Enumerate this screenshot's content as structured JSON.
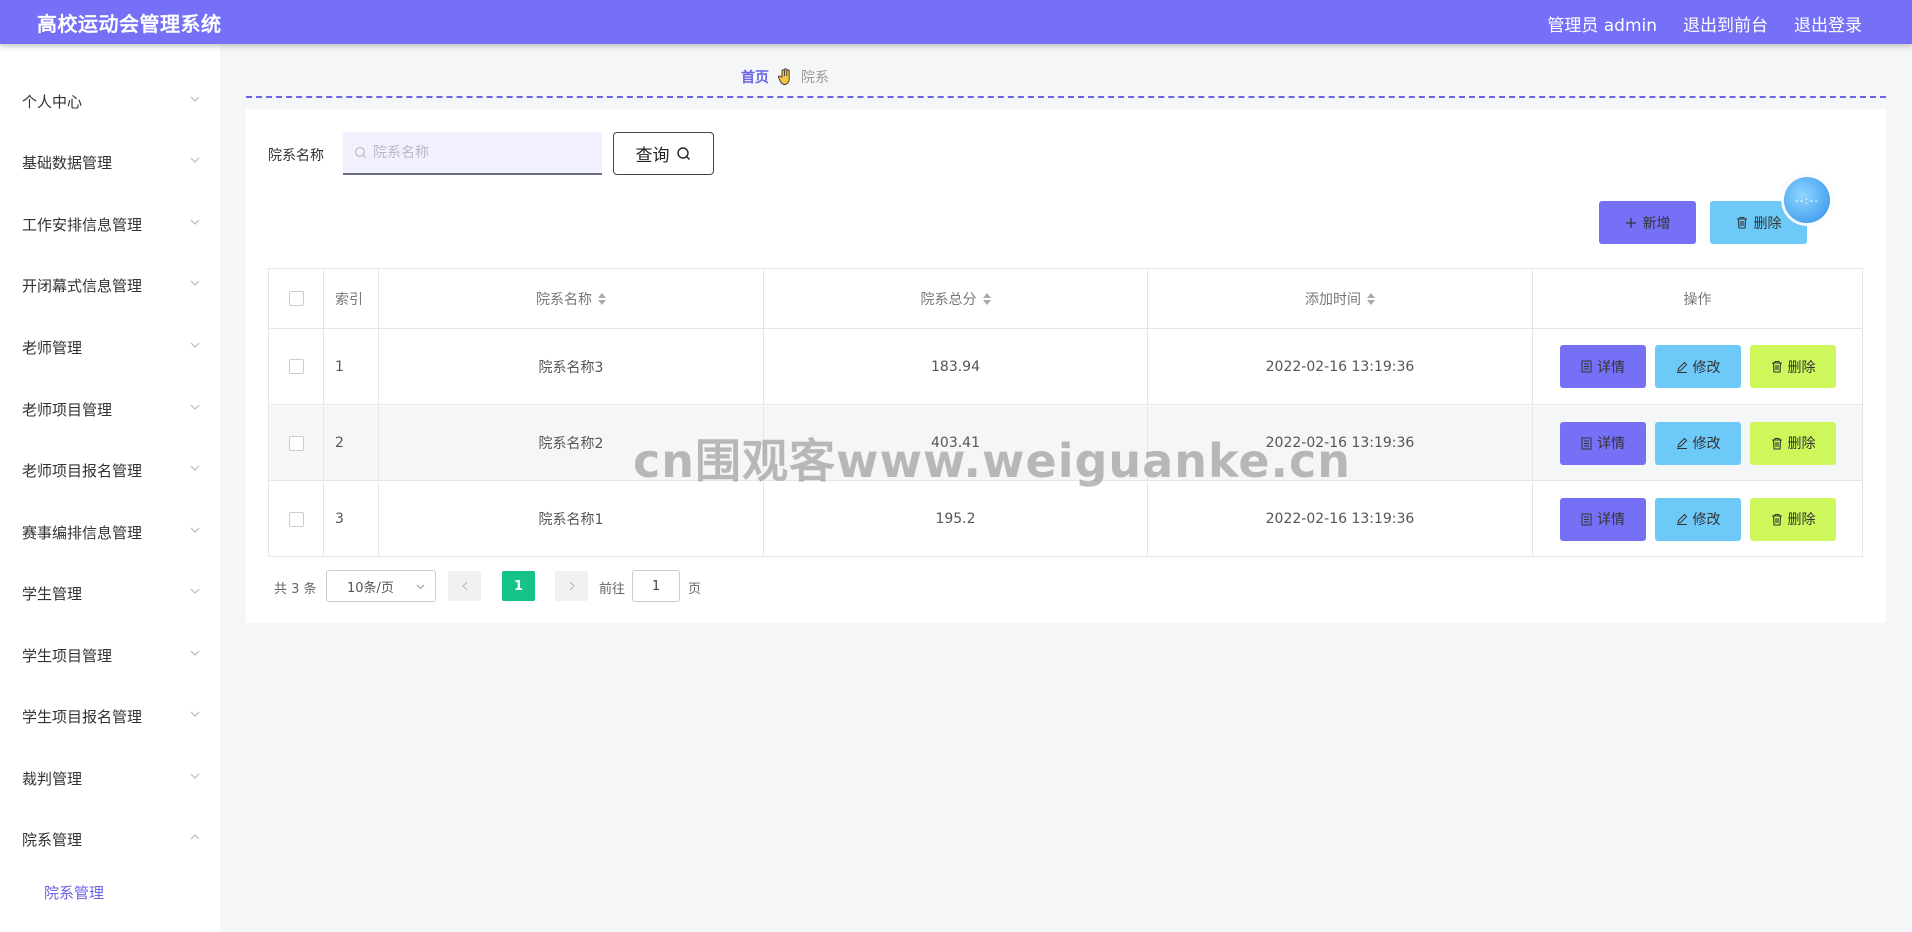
{
  "header": {
    "app_title": "高校运动会管理系统",
    "user_label": "管理员 admin",
    "to_front": "退出到前台",
    "logout": "退出登录"
  },
  "sidebar": {
    "items": [
      {
        "label": "个人中心",
        "expanded": false
      },
      {
        "label": "基础数据管理",
        "expanded": false
      },
      {
        "label": "工作安排信息管理",
        "expanded": false
      },
      {
        "label": "开闭幕式信息管理",
        "expanded": false
      },
      {
        "label": "老师管理",
        "expanded": false
      },
      {
        "label": "老师项目管理",
        "expanded": false
      },
      {
        "label": "老师项目报名管理",
        "expanded": false
      },
      {
        "label": "赛事编排信息管理",
        "expanded": false
      },
      {
        "label": "学生管理",
        "expanded": false
      },
      {
        "label": "学生项目管理",
        "expanded": false
      },
      {
        "label": "学生项目报名管理",
        "expanded": false
      },
      {
        "label": "裁判管理",
        "expanded": false
      },
      {
        "label": "院系管理",
        "expanded": true
      }
    ],
    "sub_item": "院系管理"
  },
  "breadcrumb": {
    "home": "首页",
    "current": "院系"
  },
  "search": {
    "label": "院系名称",
    "placeholder": "院系名称",
    "value": "",
    "query_label": "查询"
  },
  "actions": {
    "add_label": "新增",
    "delete_label": "删除",
    "float_ball": "--:--"
  },
  "table": {
    "headers": {
      "index": "索引",
      "name": "院系名称",
      "score": "院系总分",
      "time": "添加时间",
      "ops": "操作"
    },
    "rows": [
      {
        "index": "1",
        "name": "院系名称3",
        "score": "183.94",
        "time": "2022-02-16 13:19:36"
      },
      {
        "index": "2",
        "name": "院系名称2",
        "score": "403.41",
        "time": "2022-02-16 13:19:36"
      },
      {
        "index": "3",
        "name": "院系名称1",
        "score": "195.2",
        "time": "2022-02-16 13:19:36"
      }
    ],
    "row_buttons": {
      "detail": "详情",
      "edit": "修改",
      "delete": "删除"
    }
  },
  "pagination": {
    "total": "共 3 条",
    "page_size": "10条/页",
    "current_page": "1",
    "goto_label": "前往",
    "goto_value": "1",
    "goto_suffix": "页"
  },
  "watermark": "cn围观客www.weiguanke.cn",
  "colors": {
    "header": "#7570f5",
    "accent": "#6a63e6",
    "detail_button": "#7570f5",
    "edit_button": "#6dc9f7",
    "delete_button": "#cdf75a",
    "active_page": "#14c28a"
  }
}
